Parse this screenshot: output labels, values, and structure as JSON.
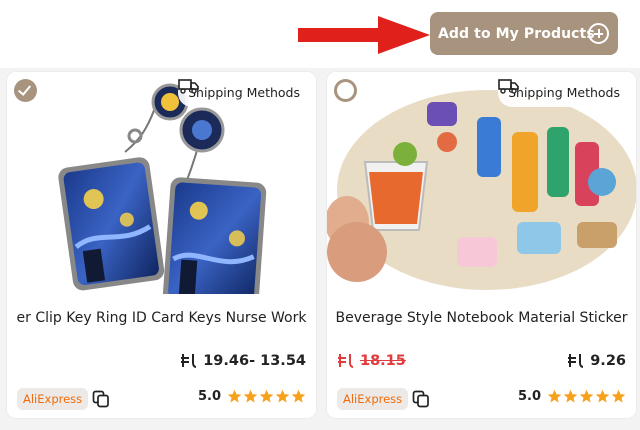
{
  "header": {
    "add_button_label": "Add to My Products",
    "add_icon": "plus-circle-icon",
    "arrow_color": "#e0201b",
    "accent_color": "#a8947e"
  },
  "products": [
    {
      "selected": true,
      "shipping_label": "Shipping Methods",
      "title": "Badge Holder Reel Retractable Clip Key Ring ID Card Keys Nurse Work",
      "title_visible": "er Clip Key Ring ID Card Keys Nurse Work",
      "price": "19.46- 13.54",
      "old_price": "",
      "store": "AliExpress",
      "rating": "5.0",
      "stars": 5
    },
    {
      "selected": false,
      "shipping_label": "Shipping Methods",
      "title": "Beverage Style Notebook Material Sticker",
      "title_visible": "Beverage Style Notebook Material Sticker",
      "price": "9.26",
      "old_price": "18.15",
      "store": "AliExpress",
      "rating": "5.0",
      "stars": 5
    }
  ]
}
